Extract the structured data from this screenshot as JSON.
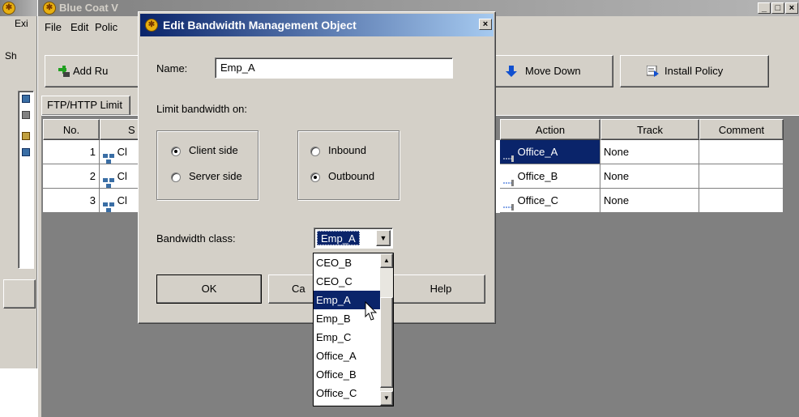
{
  "main_window": {
    "title": "Blue Coat V",
    "menu": [
      "File",
      "Edit",
      "Polic"
    ],
    "toolbar": {
      "add_rule": "Add Ru",
      "move_down": "Move Down",
      "install_policy": "Install Policy"
    },
    "tab": "FTP/HTTP Limit",
    "columns": [
      "No.",
      "S",
      "Action",
      "Track",
      "Comment"
    ],
    "rows": [
      {
        "no": "1",
        "source": "Cl",
        "action": "Office_A",
        "track": "None",
        "comment": ""
      },
      {
        "no": "2",
        "source": "Cl",
        "action": "Office_B",
        "track": "None",
        "comment": ""
      },
      {
        "no": "3",
        "source": "Cl",
        "action": "Office_C",
        "track": "None",
        "comment": ""
      }
    ]
  },
  "back_window": {
    "left_labels": [
      "Exi",
      "Sh"
    ]
  },
  "dialog": {
    "title": "Edit Bandwidth Management Object",
    "name_label": "Name:",
    "name_value": "Emp_A",
    "limit_label": "Limit bandwidth on:",
    "client_side": "Client side",
    "server_side": "Server side",
    "inbound": "Inbound",
    "outbound": "Outbound",
    "side_selected": "client",
    "direction_selected": "outbound",
    "class_label": "Bandwidth class:",
    "class_value": "Emp_A",
    "ok": "OK",
    "cancel": "Ca",
    "help": "Help",
    "dropdown_items": [
      "CEO_B",
      "CEO_C",
      "Emp_A",
      "Emp_B",
      "Emp_C",
      "Office_A",
      "Office_B",
      "Office_C"
    ],
    "dropdown_selected": "Emp_A"
  }
}
